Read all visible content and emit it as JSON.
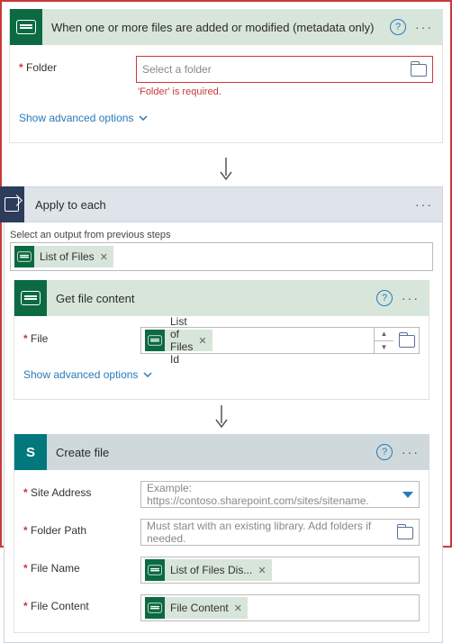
{
  "trigger": {
    "title": "When one or more files are added or modified (metadata only)",
    "folder_label": "Folder",
    "folder_placeholder": "Select a folder",
    "folder_error": "'Folder' is required.",
    "advanced": "Show advanced options"
  },
  "loop": {
    "title": "Apply to each",
    "prev_label": "Select an output from previous steps",
    "token_list_of_files": "List of Files"
  },
  "get_file": {
    "title": "Get file content",
    "file_label": "File",
    "token_list_files_id": "List of Files Id",
    "advanced": "Show advanced options"
  },
  "create_file": {
    "title": "Create file",
    "site_label": "Site Address",
    "site_placeholder": "Example: https://contoso.sharepoint.com/sites/sitename.",
    "folder_label": "Folder Path",
    "folder_placeholder": "Must start with an existing library. Add folders if needed.",
    "filename_label": "File Name",
    "token_filename": "List of Files Dis...",
    "content_label": "File Content",
    "token_content": "File Content"
  }
}
